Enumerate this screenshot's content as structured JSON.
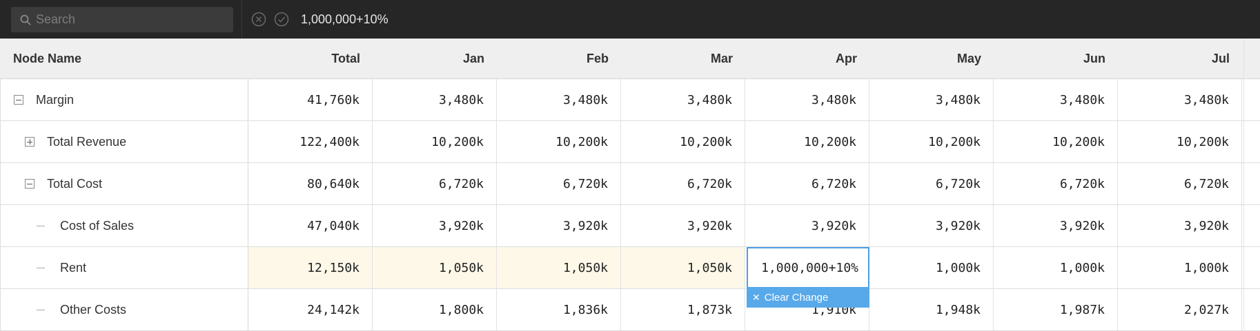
{
  "toolbar": {
    "search_placeholder": "Search",
    "formula_value": "1,000,000+10%",
    "icons": {
      "search": "search-icon",
      "cancel": "cancel-circle-icon",
      "confirm": "check-circle-icon"
    }
  },
  "grid": {
    "headers": [
      "Node Name",
      "Total",
      "Jan",
      "Feb",
      "Mar",
      "Apr",
      "May",
      "Jun",
      "Jul"
    ],
    "rows": [
      {
        "name": "Margin",
        "toggle": "minus",
        "values": [
          "41,760k",
          "3,480k",
          "3,480k",
          "3,480k",
          "3,480k",
          "3,480k",
          "3,480k",
          "3,480k"
        ]
      },
      {
        "name": "Total Revenue",
        "toggle": "plus",
        "values": [
          "122,400k",
          "10,200k",
          "10,200k",
          "10,200k",
          "10,200k",
          "10,200k",
          "10,200k",
          "10,200k"
        ]
      },
      {
        "name": "Total Cost",
        "toggle": "minus",
        "values": [
          "80,640k",
          "6,720k",
          "6,720k",
          "6,720k",
          "6,720k",
          "6,720k",
          "6,720k",
          "6,720k"
        ]
      },
      {
        "name": "Cost of Sales",
        "toggle": "leaf",
        "values": [
          "47,040k",
          "3,920k",
          "3,920k",
          "3,920k",
          "3,920k",
          "3,920k",
          "3,920k",
          "3,920k"
        ]
      },
      {
        "name": "Rent",
        "toggle": "leaf",
        "values": [
          "12,150k",
          "1,050k",
          "1,050k",
          "1,050k",
          "",
          "1,000k",
          "1,000k",
          "1,000k"
        ]
      },
      {
        "name": "Other Costs",
        "toggle": "leaf",
        "values": [
          "24,142k",
          "1,800k",
          "1,836k",
          "1,873k",
          "1,910k",
          "1,948k",
          "1,987k",
          "2,027k"
        ]
      }
    ]
  },
  "editor": {
    "value": "1,000,000+10%",
    "clear_label": "Clear Change"
  },
  "colors": {
    "toolbar_bg": "#262626",
    "accent_blue": "#4a9ee8",
    "edited_cell_bg": "#fdf8e8"
  }
}
